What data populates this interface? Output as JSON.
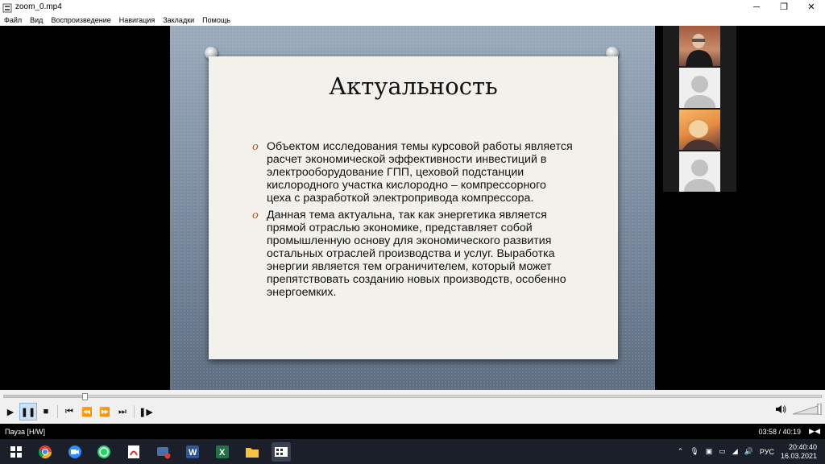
{
  "window": {
    "title": "zoom_0.mp4",
    "minimize": "─",
    "maximize": "❐",
    "close": "✕"
  },
  "menu": [
    "Файл",
    "Вид",
    "Воспроизведение",
    "Навигация",
    "Закладки",
    "Помощь"
  ],
  "slide": {
    "title": "Актуальность",
    "bullet_marker": "o",
    "bullets": [
      "Объектом исследования темы курсовой работы является расчет экономической эффективности инвестиций в электрооборудование ГПП, цеховой подстанции кислородного участка кислородно – компрессорного цеха с разработкой электропривода компрессора.",
      " Данная тема актуальна, так как энергетика является прямой отраслью экономике, представляет собой промышленную основу для экономического развития остальных отраслей производства и услуг. Выработка энергии является тем ограничителем, который может препятствовать созданию новых производств, особенно энергоемких."
    ]
  },
  "player": {
    "progress_fraction": 0.099,
    "status": "Пауза [H/W]",
    "time": "03:58 / 40:19",
    "volume_fraction": 1.0,
    "buttons": {
      "play": "▶",
      "pause": "❚❚",
      "stop": "■",
      "prev": "⏮",
      "rewind": "⏪",
      "forward": "⏩",
      "next": "⏭",
      "frame_step": "❚▶"
    }
  },
  "taskbar": {
    "language": "РУС",
    "time": "20:40:40",
    "date": "16.03.2021"
  },
  "colors": {
    "accent": "#b8541a",
    "taskbar": "#1a1f2a"
  }
}
